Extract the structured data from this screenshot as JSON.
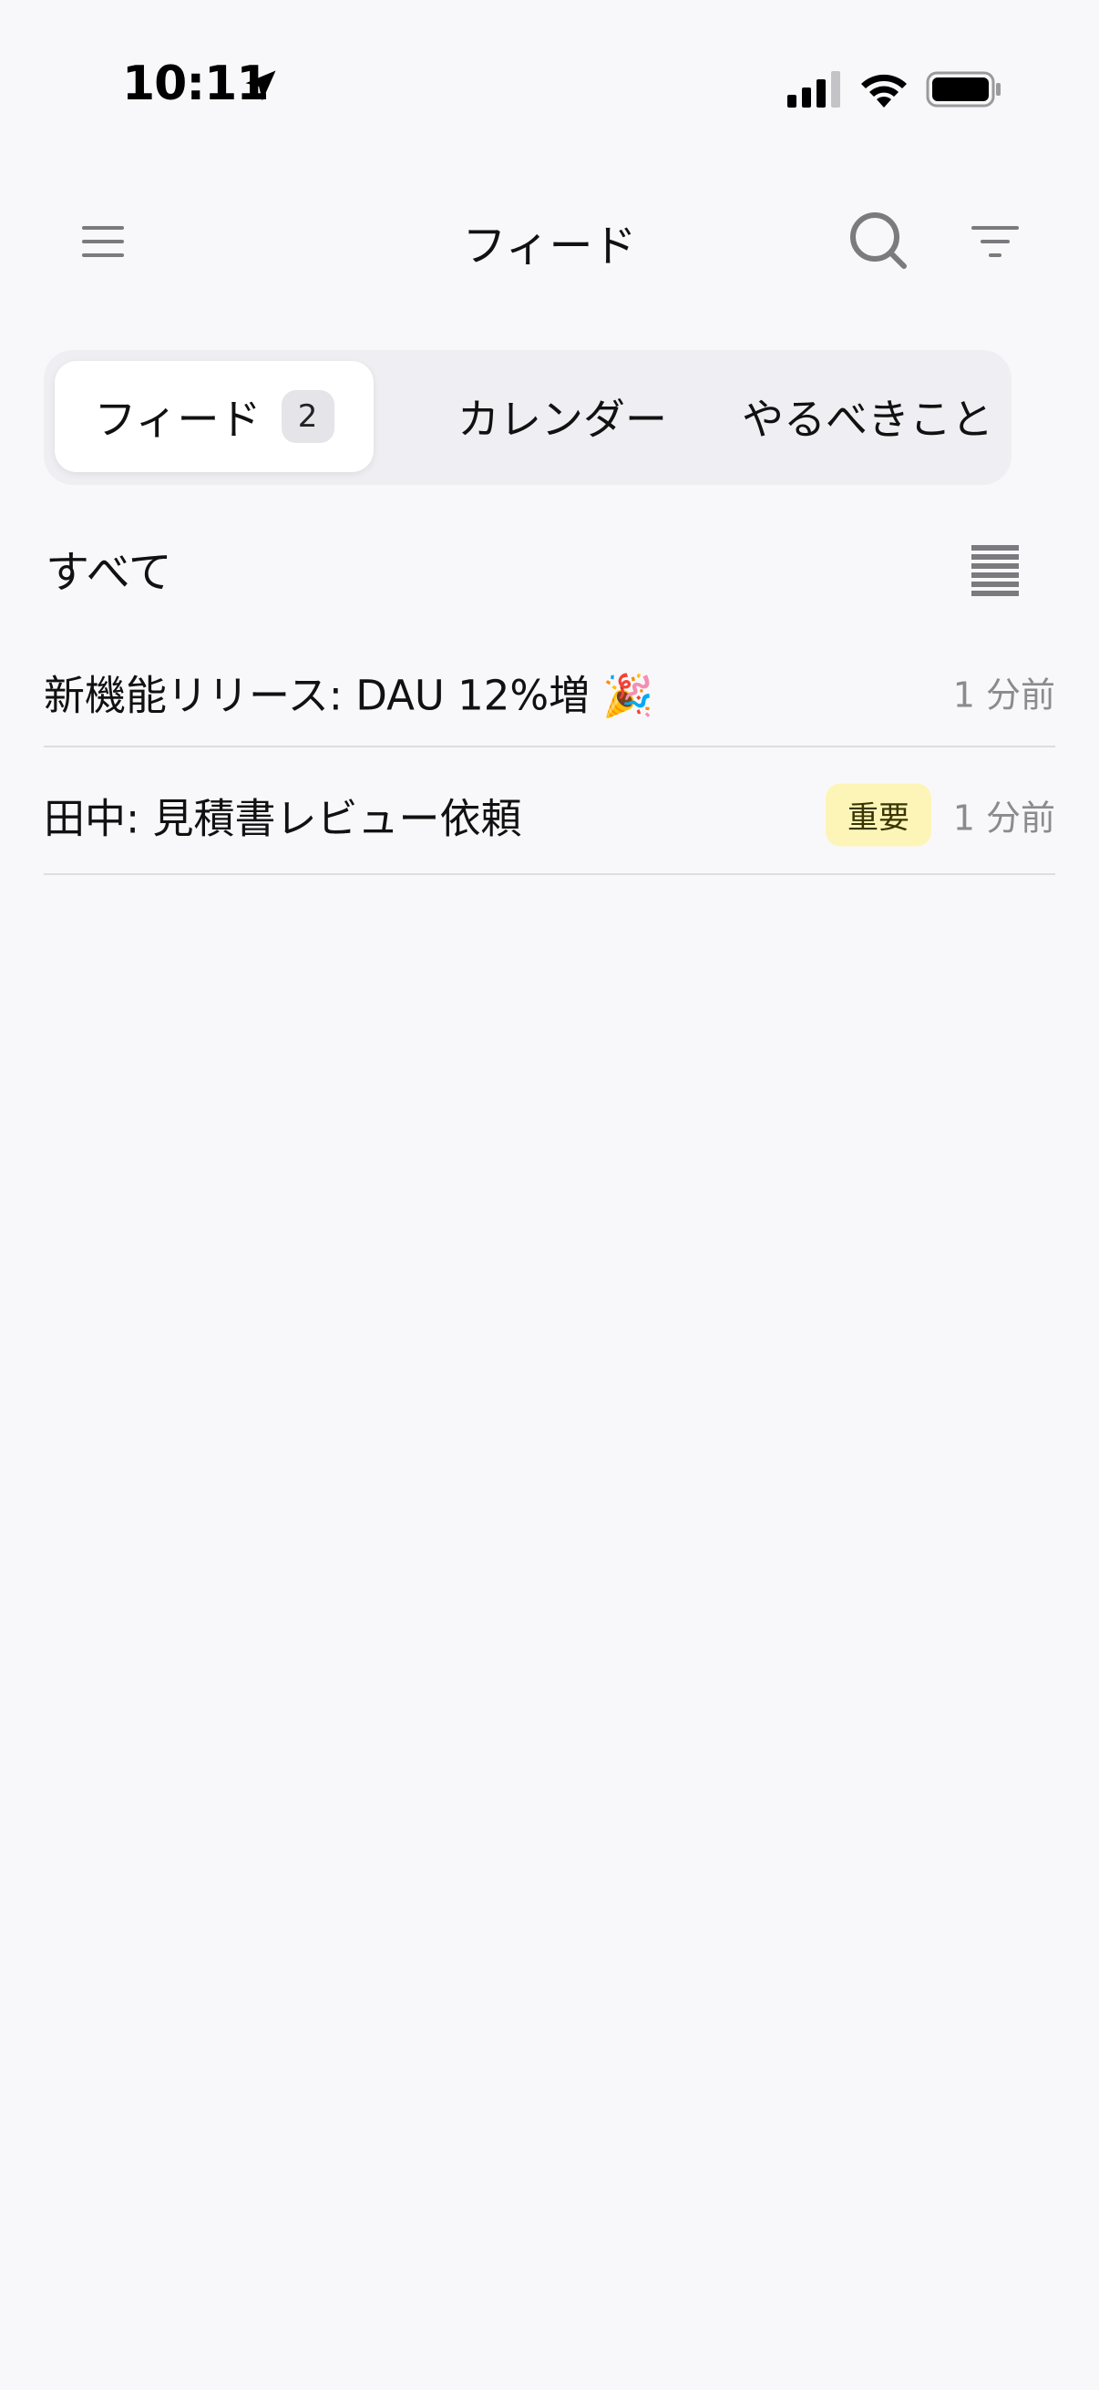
{
  "status_bar": {
    "time": "10:11"
  },
  "header": {
    "title": "フィード"
  },
  "tabs": [
    {
      "label": "フィード",
      "badge": "2",
      "active": true
    },
    {
      "label": "カレンダー"
    },
    {
      "label": "やるべきこと"
    }
  ],
  "section": {
    "title": "すべて"
  },
  "feed": [
    {
      "title": "新機能リリース: DAU 12%増 🎉",
      "time": "1 分前"
    },
    {
      "title": "田中: 見積書レビュー依頼",
      "tag": "重要",
      "time": "1 分前"
    }
  ],
  "colors": {
    "background": "#f8f8fa",
    "tag_important_bg": "#fdf5b8",
    "divider": "#dddde2"
  },
  "icons": [
    "location-arrow-icon",
    "cellular-signal-icon",
    "wifi-icon",
    "battery-icon",
    "hamburger-menu-icon",
    "search-icon",
    "filter-icon",
    "list-view-icon"
  ]
}
